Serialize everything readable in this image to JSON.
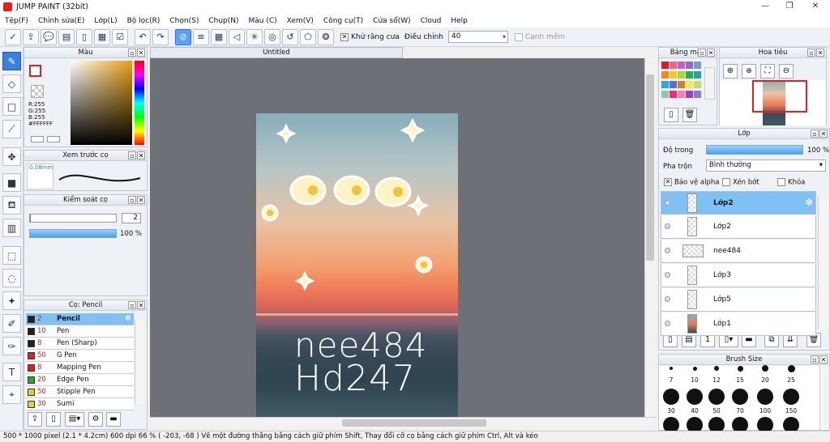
{
  "window": {
    "title": "JUMP PAINT (32bit)",
    "minimize": "—",
    "maximize": "❐",
    "close": "✕"
  },
  "menu": [
    "Tệp(F)",
    "Chỉnh sửa(E)",
    "Lớp(L)",
    "Bộ lọc(R)",
    "Chọn(S)",
    "Chụp(N)",
    "Màu (C)",
    "Xem(V)",
    "Công cụ(T)",
    "Cửa sổ(W)",
    "Cloud",
    "Help"
  ],
  "toolbar": {
    "antialias_label": "Khử răng cưa",
    "adjust_label": "Điều chỉnh",
    "adjust_value": "40",
    "snap_label": "Cạnh mềm",
    "antialias_checked": "✕"
  },
  "color_panel": {
    "title": "Màu",
    "r": "R:255",
    "g": "G:255",
    "b": "B:255",
    "hex": "#FFFFFF"
  },
  "preview_panel": {
    "title": "Xem trước cọ",
    "size": "0.08mm"
  },
  "brush_control": {
    "title": "Kiểm soát cọ",
    "size_value": "2",
    "opacity_value": "100 %"
  },
  "brush_list": {
    "title": "Cọ: Pencil",
    "items": [
      {
        "size": "2",
        "name": "Pencil",
        "color": "#222222"
      },
      {
        "size": "10",
        "name": "Pen",
        "color": "#222222"
      },
      {
        "size": "8",
        "name": "Pen (Sharp)",
        "color": "#222222"
      },
      {
        "size": "50",
        "name": "G Pen",
        "color": "#e02020"
      },
      {
        "size": "8",
        "name": "Mapping Pen",
        "color": "#e02020"
      },
      {
        "size": "20",
        "name": "Edge Pen",
        "color": "#20b020"
      },
      {
        "size": "50",
        "name": "Stipple Pen",
        "color": "#e8d020"
      },
      {
        "size": "30",
        "name": "Sumi",
        "color": "#e8d020"
      }
    ]
  },
  "document": {
    "tab": "Untitled",
    "art_line1": "nee484",
    "art_line2": "Hd247"
  },
  "palette_panel": {
    "title": "Bảng màu",
    "colors": [
      "#d0202a",
      "#e06a8a",
      "#c35fc0",
      "#8e6ec5",
      "#7a9ad0",
      "#e88e2a",
      "#f0c830",
      "#b0d040",
      "#2eaa58",
      "#2aa0a0",
      "#3aa0e0",
      "#4a78d0",
      "#d08030",
      "#f5e66a",
      "#c8d878",
      "#8cc8a0",
      "#e8307a",
      "#f080b0",
      "#a040c0",
      "#8080d0"
    ]
  },
  "navigator_panel": {
    "title": "Hoa tiêu"
  },
  "layer_panel": {
    "title": "Lớp",
    "opacity_label": "Độ trong",
    "opacity_value": "100 %",
    "blend_label": "Pha trộn",
    "blend_value": "Bình thường",
    "protect_alpha": "Bảo vệ alpha",
    "clip": "Xén bớt",
    "lock": "Khóa",
    "layers": [
      "Lớp2",
      "Lớp2",
      "nee484",
      "Lớp3",
      "Lớp5",
      "Lớp1"
    ]
  },
  "brush_size_panel": {
    "title": "Brush Size",
    "row1": [
      "7",
      "10",
      "12",
      "15",
      "20",
      "25"
    ],
    "row2": [
      "30",
      "40",
      "50",
      "70",
      "100",
      "150"
    ]
  },
  "status": {
    "text": "500 * 1000 pixel   (2.1 * 4.2cm)   600 dpi   66 %   ( -203, -68 )   Vẽ một đường thẳng bằng cách giữ phím Shift, Thay đổi cỡ cọ bằng cách giữ phím Ctrl, Alt và kéo"
  },
  "colors": {
    "accent": "#3b7fe0",
    "selected_row": "#7fc1f5"
  }
}
